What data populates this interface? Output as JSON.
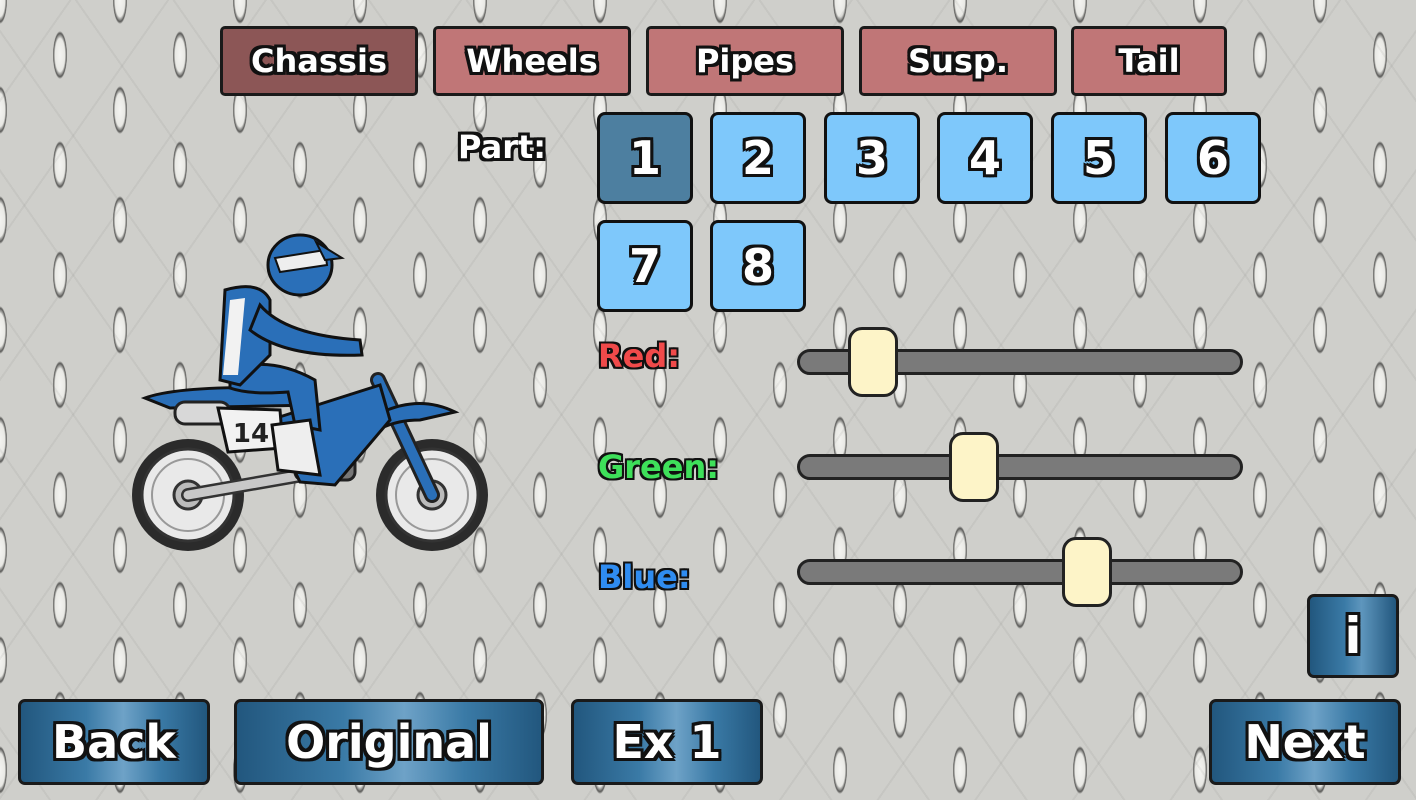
{
  "tabs": [
    {
      "label": "Chassis",
      "active": true
    },
    {
      "label": "Wheels",
      "active": false
    },
    {
      "label": "Pipes",
      "active": false
    },
    {
      "label": "Susp.",
      "active": false
    },
    {
      "label": "Tail",
      "active": false
    }
  ],
  "part": {
    "label": "Part:",
    "selected": "1",
    "options": [
      "1",
      "2",
      "3",
      "4",
      "5",
      "6",
      "7",
      "8"
    ]
  },
  "sliders": [
    {
      "label": "Red:",
      "color": "#f04a4a",
      "value": 0.15
    },
    {
      "label": "Green:",
      "color": "#3ee05a",
      "value": 0.39
    },
    {
      "label": "Blue:",
      "color": "#2f8cf0",
      "value": 0.66
    }
  ],
  "bike": {
    "number": "14",
    "accent": "#2a6fb8"
  },
  "buttons": {
    "back": "Back",
    "original": "Original",
    "ex1": "Ex 1",
    "next": "Next",
    "info": "i"
  }
}
